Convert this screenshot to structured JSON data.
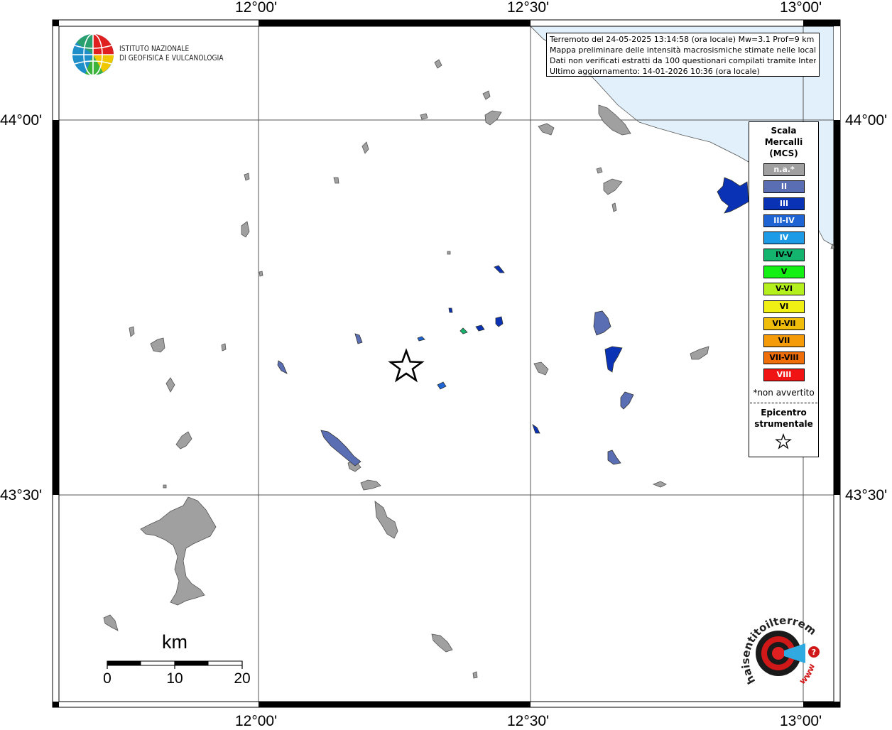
{
  "map": {
    "lon_labels": [
      "12°00'",
      "12°30'",
      "13°00'"
    ],
    "lat_labels": [
      "44°00'",
      "43°30'"
    ]
  },
  "info": {
    "line1": "Terremoto del 24-05-2025 13:14:58 (ora locale) Mw=3.1 Prof=9 km",
    "line2": "Mappa preliminare delle intensità macrosismiche stimate nelle località",
    "line3": "Dati non verificati estratti da 100 questionari compilati tramite Internet.",
    "line4": "Ultimo aggiornamento: 14-01-2026 10:36 (ora locale)"
  },
  "logo": {
    "line1": "ISTITUTO NAZIONALE",
    "line2": "DI GEOFISICA E VULCANOLOGIA"
  },
  "legend": {
    "title_line1": "Scala",
    "title_line2": "Mercalli",
    "title_line3": "(MCS)",
    "items": [
      {
        "label": "n.a.*",
        "color": "#a0a0a0",
        "text_color": "#ffffff"
      },
      {
        "label": "II",
        "color": "#5a6eb4",
        "text_color": "#ffffff"
      },
      {
        "label": "III",
        "color": "#0a32b4",
        "text_color": "#ffffff"
      },
      {
        "label": "III-IV",
        "color": "#1e64d2",
        "text_color": "#ffffff"
      },
      {
        "label": "IV",
        "color": "#1e9be6",
        "text_color": "#ffffff"
      },
      {
        "label": "IV-V",
        "color": "#14b46e",
        "text_color": "#000000"
      },
      {
        "label": "V",
        "color": "#14f014",
        "text_color": "#000000"
      },
      {
        "label": "V-VI",
        "color": "#b4f01e",
        "text_color": "#000000"
      },
      {
        "label": "VI",
        "color": "#f0f014",
        "text_color": "#000000"
      },
      {
        "label": "VI-VII",
        "color": "#f0be0a",
        "text_color": "#000000"
      },
      {
        "label": "VII",
        "color": "#f59b0a",
        "text_color": "#000000"
      },
      {
        "label": "VII-VIII",
        "color": "#f06e0a",
        "text_color": "#000000"
      },
      {
        "label": "VIII",
        "color": "#f01414",
        "text_color": "#ffffff"
      }
    ],
    "note": "*non avvertito",
    "epicenter_line1": "Epicentro",
    "epicenter_line2": "strumentale"
  },
  "scalebar": {
    "title": "km",
    "labels": [
      "0",
      "10",
      "20"
    ]
  },
  "hsit": {
    "text": "haisentitoilterremoto.it",
    "www": "www."
  },
  "colors": {
    "sea": "#e1f0fa",
    "grey_locality": "#a0a0a0",
    "frame": "#000000"
  }
}
